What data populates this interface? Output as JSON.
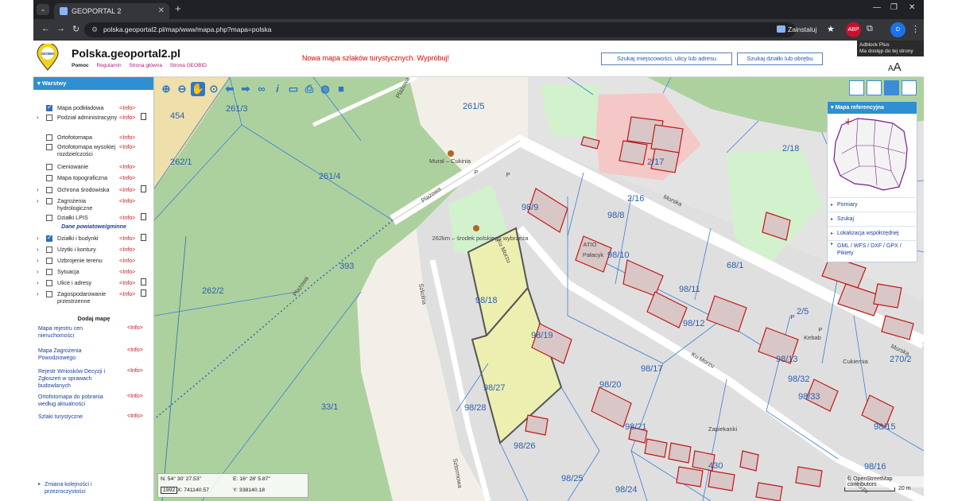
{
  "browser": {
    "tab_title": "GEOPORTAL 2",
    "url": "polska.geoportal2.pl/map/www/mapa.php?mapa=polska",
    "install_label": "Zainstaluj",
    "abp_label": "ABP",
    "profile_label": "D",
    "tooltip": "Adblock Plus\nMa dostęp do tej strony"
  },
  "header": {
    "logo_text": "GEOBID",
    "site_title": "Polska.geoportal2.pl",
    "links": [
      "Pomoc",
      "Regulamin",
      "Strona główna",
      "Strona GEOBID"
    ],
    "promo": "Nowa mapa szlaków turystycznych. Wypróbuj!",
    "search_place_btn": "Szukaj miejscowości, ulicy lub adresu",
    "search_parcel_btn": "Szukaj działki lub obrębu",
    "font_toggle": "AA"
  },
  "sidebar": {
    "title": "Warstwy",
    "layers": [
      {
        "label": "Mapa podkładowa",
        "info": "<Info>",
        "checked": true,
        "expand": false,
        "doc": false
      },
      {
        "label": "Podział administracyjny",
        "info": "<Info>",
        "checked": false,
        "expand": true,
        "doc": true
      },
      {
        "label": "Ortofotomapa",
        "info": "<Info>",
        "checked": false,
        "expand": false,
        "doc": false
      },
      {
        "label": "Ortofotomapa wysokiej rozdzielczości",
        "info": "<Info>",
        "checked": false,
        "expand": false,
        "doc": false
      },
      {
        "label": "Cieniowanie",
        "info": "<Info>",
        "checked": false,
        "expand": false,
        "doc": false
      },
      {
        "label": "Mapa topograficzna",
        "info": "<Info>",
        "checked": false,
        "expand": false,
        "doc": false
      },
      {
        "label": "Ochrona środowiska",
        "info": "<Info>",
        "checked": false,
        "expand": true,
        "doc": true
      },
      {
        "label": "Zagrożenia hydrologiczne",
        "info": "<Info>",
        "checked": false,
        "expand": true,
        "doc": false
      },
      {
        "label": "Działki LPIS",
        "info": "<Info>",
        "checked": false,
        "expand": false,
        "doc": true
      }
    ],
    "section_label": "Dane powiatowe/gminne",
    "county_layers": [
      {
        "label": "Działki i budynki",
        "info": "<Info>",
        "checked": true,
        "expand": true,
        "doc": true
      },
      {
        "label": "Użytki i kontury",
        "info": "<Info>",
        "checked": false,
        "expand": true,
        "doc": false
      },
      {
        "label": "Uzbrojenie terenu",
        "info": "<Info>",
        "checked": false,
        "expand": true,
        "doc": false
      },
      {
        "label": "Sytuacja",
        "info": "<Info>",
        "checked": false,
        "expand": true,
        "doc": false
      },
      {
        "label": "Ulice i adresy",
        "info": "<Info>",
        "checked": false,
        "expand": true,
        "doc": true
      },
      {
        "label": "Zagospodarowanie przestrzenne",
        "info": "<Info>",
        "checked": false,
        "expand": true,
        "doc": true
      }
    ],
    "add_map_title": "Dodaj mapę",
    "add_maps": [
      {
        "label": "Mapa rejestru cen nieruchomości",
        "info": "<Info>"
      },
      {
        "label": "Mapa Zagrożenia Powodziowego",
        "info": "<Info>"
      },
      {
        "label": "Rejestr Wniosków Decyzji i Zgłoszeń w sprawach budowlanych",
        "info": "<Info>"
      },
      {
        "label": "Ortofotomapa do pobrania według aktualności",
        "info": "<Info>"
      },
      {
        "label": "Szlaki turystyczne",
        "info": "<Info>"
      }
    ],
    "footer_link": "Zmiana kolejności i przezroczystości"
  },
  "map": {
    "ref_panel_title": "Mapa referencyjna",
    "ref_rows": [
      "Pomiary",
      "Szukaj",
      "Lokalizacja współrzędnej",
      "GML / WFS / DXF / GPX / Pikiety"
    ],
    "coords": {
      "n": "N: 54° 30' 27.53\"",
      "e": "E: 16° 28' 5.87\"",
      "crs": "1992",
      "x": "X: 741140.57",
      "y": "Y: 338140.18"
    },
    "attribution": "© OpenStreetMap contributors",
    "scale_label": "20 m",
    "parcels": [
      "261/3",
      "454",
      "261/5",
      "262/1",
      "261/4",
      "393",
      "262/2",
      "33/1",
      "98/18",
      "98/19",
      "98/27",
      "98/26",
      "98/28",
      "98/25",
      "98/24",
      "98/20",
      "98/21",
      "98/17",
      "98/13",
      "98/11",
      "98/12",
      "98/10",
      "98/9",
      "98/8",
      "2/16",
      "2/17",
      "2/18",
      "68/1",
      "98/32",
      "98/33",
      "98/15",
      "98/16",
      "2/5",
      "270/2",
      "430"
    ],
    "streets": [
      "Plażowa",
      "Plażowa",
      "Plażowa",
      "Morska",
      "Morska",
      "Ku Morzu",
      "Ku Morzu",
      "Szkolna",
      "Sztormowa",
      "Ku Morzu"
    ],
    "pois": [
      "Mural – Cukinia",
      "262km – środek polskiego wybrzeża",
      "ATIO",
      "Pałacyk",
      "Zapiekanki",
      "Cukiernia",
      "Kebab"
    ]
  }
}
